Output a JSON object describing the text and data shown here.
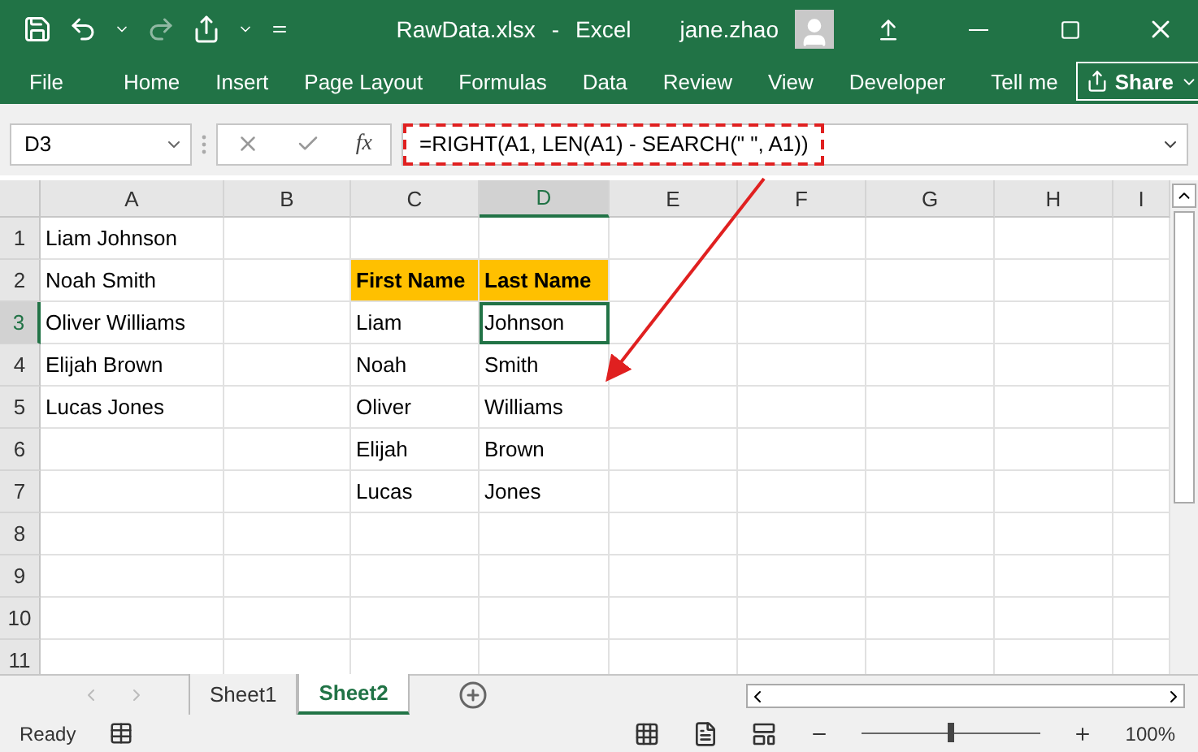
{
  "title_bar": {
    "file": "RawData.xlsx",
    "separator": "-",
    "app": "Excel",
    "user": "jane.zhao"
  },
  "ribbon_tabs": [
    {
      "label": "File"
    },
    {
      "label": "Home"
    },
    {
      "label": "Insert"
    },
    {
      "label": "Page Layout"
    },
    {
      "label": "Formulas"
    },
    {
      "label": "Data"
    },
    {
      "label": "Review"
    },
    {
      "label": "View"
    },
    {
      "label": "Developer"
    }
  ],
  "tell_me": "Tell me",
  "share": "Share",
  "formula_bar": {
    "name_box": "D3",
    "fx": "fx",
    "formula": "=RIGHT(A1, LEN(A1) - SEARCH(\" \", A1))"
  },
  "columns": [
    {
      "label": "A",
      "selected": false
    },
    {
      "label": "B",
      "selected": false
    },
    {
      "label": "C",
      "selected": false
    },
    {
      "label": "D",
      "selected": true
    },
    {
      "label": "E",
      "selected": false
    },
    {
      "label": "F",
      "selected": false
    },
    {
      "label": "G",
      "selected": false
    },
    {
      "label": "H",
      "selected": false
    },
    {
      "label": "I",
      "selected": false
    }
  ],
  "rows": [
    {
      "number": "1",
      "selected": false,
      "cells": [
        {
          "text": "Liam Johnson"
        },
        {},
        {},
        {}
      ]
    },
    {
      "number": "2",
      "selected": false,
      "cells": [
        {
          "text": "Noah Smith"
        },
        {},
        {
          "text": "First Name",
          "kind": "header"
        },
        {
          "text": "Last Name",
          "kind": "header"
        }
      ]
    },
    {
      "number": "3",
      "selected": true,
      "cells": [
        {
          "text": "Oliver Williams"
        },
        {},
        {
          "text": "Liam"
        },
        {
          "text": "Johnson"
        }
      ]
    },
    {
      "number": "4",
      "selected": false,
      "cells": [
        {
          "text": "Elijah Brown"
        },
        {},
        {
          "text": "Noah"
        },
        {
          "text": "Smith"
        }
      ]
    },
    {
      "number": "5",
      "selected": false,
      "cells": [
        {
          "text": "Lucas Jones"
        },
        {},
        {
          "text": "Oliver"
        },
        {
          "text": "Williams"
        }
      ]
    },
    {
      "number": "6",
      "selected": false,
      "cells": [
        {},
        {},
        {
          "text": "Elijah"
        },
        {
          "text": "Brown"
        }
      ]
    },
    {
      "number": "7",
      "selected": false,
      "cells": [
        {},
        {},
        {
          "text": "Lucas"
        },
        {
          "text": "Jones"
        }
      ]
    },
    {
      "number": "8",
      "selected": false,
      "cells": [
        {},
        {},
        {},
        {}
      ]
    },
    {
      "number": "9",
      "selected": false,
      "cells": [
        {},
        {},
        {},
        {}
      ]
    },
    {
      "number": "10",
      "selected": false,
      "cells": [
        {},
        {},
        {},
        {}
      ]
    },
    {
      "number": "11",
      "selected": false,
      "cells": [
        {},
        {},
        {},
        {}
      ]
    }
  ],
  "sheets": [
    {
      "label": "Sheet1",
      "selected": false
    },
    {
      "label": "Sheet2",
      "selected": true
    }
  ],
  "status_bar": {
    "status": "Ready",
    "zoom": "100%",
    "zoom_slider": {
      "level": 0.5
    }
  }
}
